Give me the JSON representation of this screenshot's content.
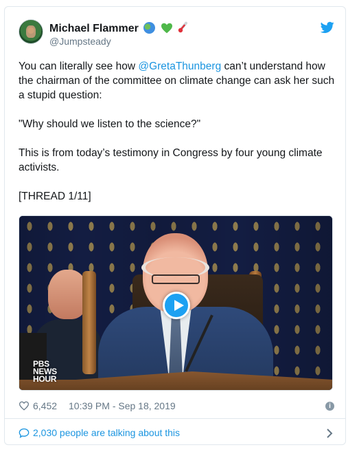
{
  "author": {
    "name": "Michael Flammer",
    "handle": "@Jumpsteady",
    "emoji_icons": [
      "globe-icon",
      "green-heart-icon",
      "thermometer-icon"
    ]
  },
  "tweet": {
    "line1_pre": "You can literally see how ",
    "mention": "@GretaThunberg",
    "line1_post": " can’t understand how the chairman of the committee on climate change can ask her such a stupid question:",
    "quote": "\"Why should we listen to the science?\"",
    "paragraph3": "This is from today’s testimony in Congress by four young climate activists.",
    "thread": "[THREAD 1/11]"
  },
  "media": {
    "type": "video",
    "logo_lines": [
      "PBS",
      "NEWS",
      "HOUR"
    ]
  },
  "meta": {
    "likes": "6,452",
    "timestamp": "10:39 PM - Sep 18, 2019"
  },
  "footer": {
    "talking": "2,030 people are talking about this"
  },
  "colors": {
    "link": "#1b95e0",
    "twitter_blue": "#1da1f2",
    "muted": "#657786"
  }
}
